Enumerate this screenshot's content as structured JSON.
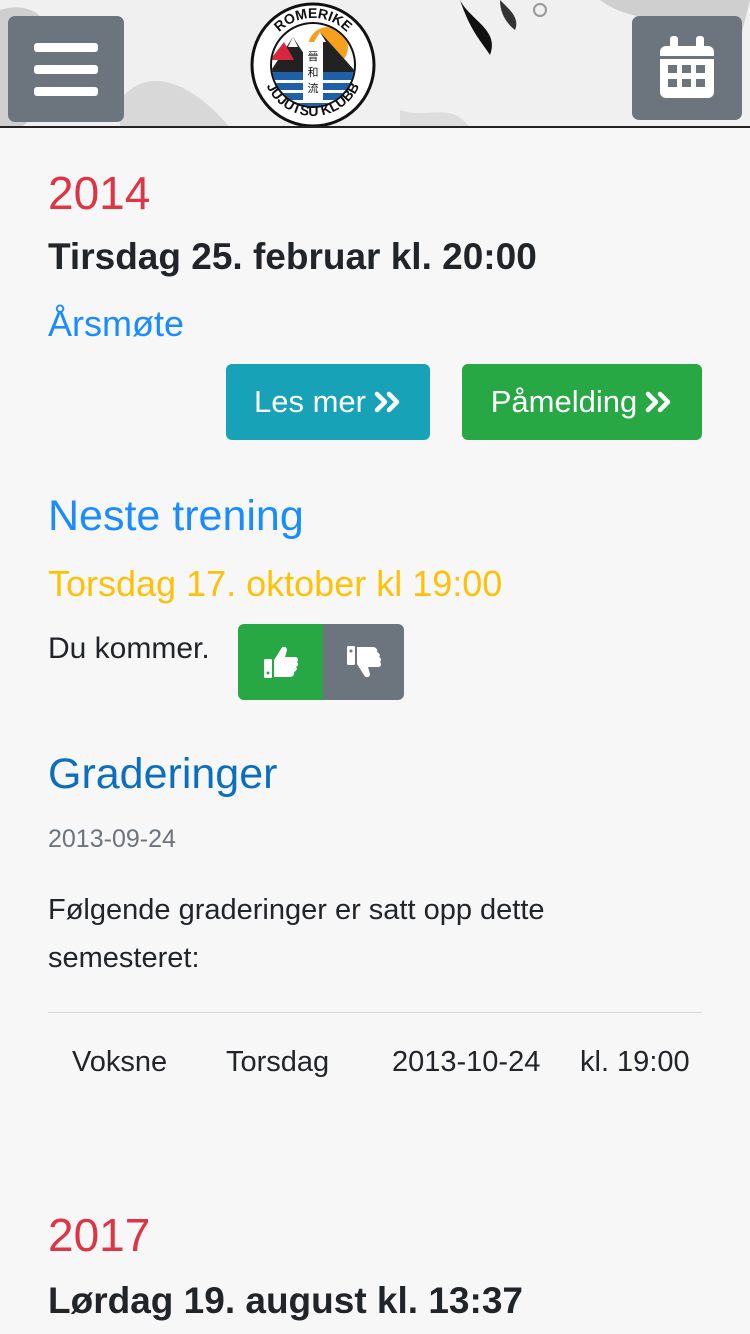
{
  "header": {
    "menu_icon": "hamburger-menu-icon",
    "calendar_icon": "calendar-icon",
    "logo": {
      "top_text": "ROMERIKE",
      "bottom_text": "JUJUTSU KLUBB",
      "kanji": "晉和流"
    }
  },
  "events": [
    {
      "year": "2014",
      "date": "Tirsdag 25. februar kl. 20:00",
      "title": "Årsmøte",
      "read_more_label": "Les mer",
      "register_label": "Påmelding"
    },
    {
      "year": "2017",
      "date": "Lørdag 19. august kl. 13:37"
    }
  ],
  "next_training": {
    "heading": "Neste trening",
    "date": "Torsdag 17. oktober kl 19:00",
    "status": "Du kommer.",
    "thumb_up_icon": "thumbs-up-icon",
    "thumb_down_icon": "thumbs-down-icon"
  },
  "graderinger": {
    "heading": "Graderinger",
    "date": "2013-09-24",
    "text": "Følgende graderinger er satt opp dette semesteret:",
    "table": [
      {
        "group": "Voksne",
        "day": "Torsdag",
        "date": "2013-10-24",
        "time": "kl. 19:00"
      }
    ]
  },
  "colors": {
    "year": "#dc3545",
    "link": "#1a8cff",
    "info": "#17a2b8",
    "success": "#28a745",
    "warning": "#ffc107",
    "secondary": "#6c757d"
  }
}
